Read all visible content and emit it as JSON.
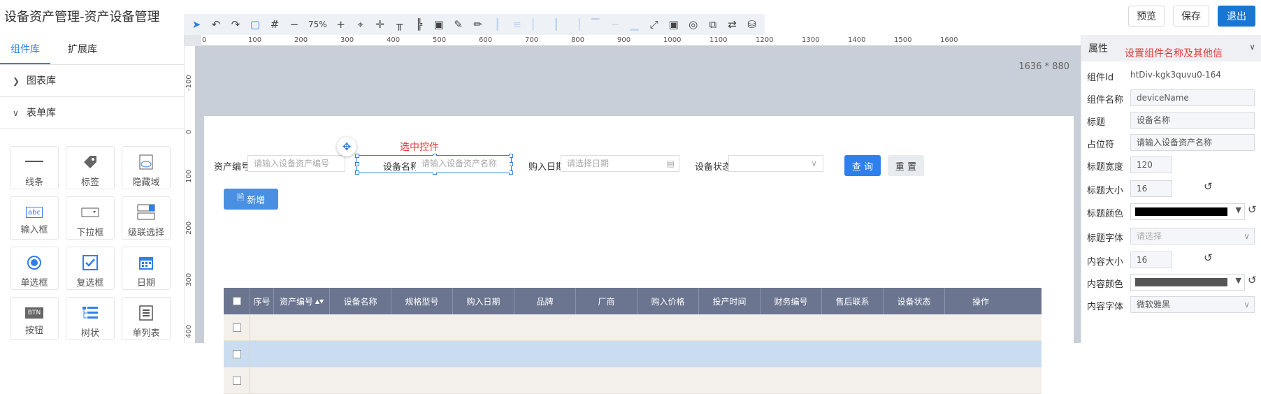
{
  "app": {
    "title": "设备资产管理-资产设备管理"
  },
  "toolbar": {
    "zoom": "75%"
  },
  "header_buttons": {
    "preview": "预览",
    "save": "保存",
    "exit": "退出"
  },
  "left_panel": {
    "tabs": [
      "组件库",
      "扩展库"
    ],
    "categories": [
      {
        "label": "图表库",
        "expanded": false
      },
      {
        "label": "表单库",
        "expanded": true
      }
    ],
    "widgets": [
      {
        "label": "线条",
        "icon": "line-icon"
      },
      {
        "label": "标签",
        "icon": "tag-icon"
      },
      {
        "label": "隐藏域",
        "icon": "hidden-field-icon"
      },
      {
        "label": "输入框",
        "icon": "input-box-icon",
        "icon_text": "abc"
      },
      {
        "label": "下拉框",
        "icon": "dropdown-icon"
      },
      {
        "label": "级联选择",
        "icon": "cascade-select-icon"
      },
      {
        "label": "单选框",
        "icon": "radio-icon"
      },
      {
        "label": "复选框",
        "icon": "checkbox-icon"
      },
      {
        "label": "日期",
        "icon": "calendar-icon"
      },
      {
        "label": "按钮",
        "icon": "button-icon",
        "icon_text": "BTN"
      },
      {
        "label": "树状",
        "icon": "tree-icon"
      },
      {
        "label": "单列表",
        "icon": "single-list-icon"
      }
    ]
  },
  "rulers": {
    "horizontal": [
      "0",
      "100",
      "200",
      "300",
      "400",
      "500",
      "600",
      "700",
      "800",
      "900",
      "1000",
      "1100",
      "1200",
      "1300",
      "1400",
      "1500",
      "1600"
    ],
    "vertical": [
      "-100",
      "0",
      "100",
      "200",
      "300",
      "400"
    ]
  },
  "canvas": {
    "dimensions": "1636 * 880",
    "annotation_selected": "选中控件",
    "form": {
      "asset_no_label": "资产编号",
      "asset_no_placeholder": "请输入设备资产编号",
      "device_name_label": "设备名称",
      "device_name_placeholder": "请输入设备资产名称",
      "purchase_date_label": "购入日期",
      "purchase_date_placeholder": "请选择日期",
      "status_label": "设备状态",
      "query_label": "查 询",
      "reset_label": "重 置",
      "add_label": "新增"
    },
    "table": {
      "columns": [
        "序号",
        "资产编号",
        "设备名称",
        "规格型号",
        "购入日期",
        "品牌",
        "厂商",
        "购入价格",
        "投产时间",
        "财务编号",
        "售后联系",
        "设备状态",
        "操作"
      ],
      "row_count": 3
    }
  },
  "right_panel": {
    "title": "属性",
    "annotation": "设置组件名称及其他信",
    "component_id_label": "组件Id",
    "component_id_value": "htDiv-kgk3quvu0-164",
    "properties": [
      {
        "label": "组件名称",
        "value": "deviceName",
        "type": "input"
      },
      {
        "label": "标题",
        "value": "设备名称",
        "type": "input"
      },
      {
        "label": "占位符",
        "value": "请输入设备资产名称",
        "type": "input"
      },
      {
        "label": "标题宽度",
        "value": "120",
        "type": "number"
      },
      {
        "label": "标题大小",
        "value": "16",
        "type": "number"
      },
      {
        "label": "标题颜色",
        "value": "#000000",
        "type": "color"
      },
      {
        "label": "标题字体",
        "value": "请选择",
        "type": "select"
      },
      {
        "label": "内容大小",
        "value": "16",
        "type": "number"
      },
      {
        "label": "内容颜色",
        "value": "#555555",
        "type": "color"
      },
      {
        "label": "内容字体",
        "value": "微软雅黑",
        "type": "select"
      }
    ]
  },
  "colors": {
    "accent": "#2f80ed",
    "primary_button": "#1976d2",
    "table_header": "#6b7590",
    "selected_row": "#c9dcf0",
    "even_row": "#f3efea",
    "annotation_red": "#e53935"
  }
}
